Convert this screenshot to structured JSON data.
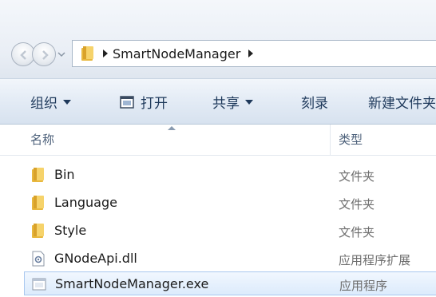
{
  "address_bar": {
    "path": [
      "SmartNodeManager"
    ]
  },
  "toolbar": {
    "organize_label": "组织",
    "open_label": "打开",
    "share_label": "共享",
    "burn_label": "刻录",
    "new_folder_label": "新建文件夹"
  },
  "columns": {
    "name_label": "名称",
    "type_label": "类型"
  },
  "files": [
    {
      "name": "Bin",
      "type": "文件夹",
      "icon": "folder-icon"
    },
    {
      "name": "Language",
      "type": "文件夹",
      "icon": "folder-icon"
    },
    {
      "name": "Style",
      "type": "文件夹",
      "icon": "folder-icon"
    },
    {
      "name": "GNodeApi.dll",
      "type": "应用程序扩展",
      "icon": "dll-file-icon"
    },
    {
      "name": "SmartNodeManager.exe",
      "type": "应用程序",
      "icon": "exe-file-icon"
    }
  ],
  "selected_file": "SmartNodeManager.exe",
  "colors": {
    "toolbar_text": "#1e395b",
    "selection_bg": "#dcebfc",
    "selection_border": "#a9c8ef"
  }
}
